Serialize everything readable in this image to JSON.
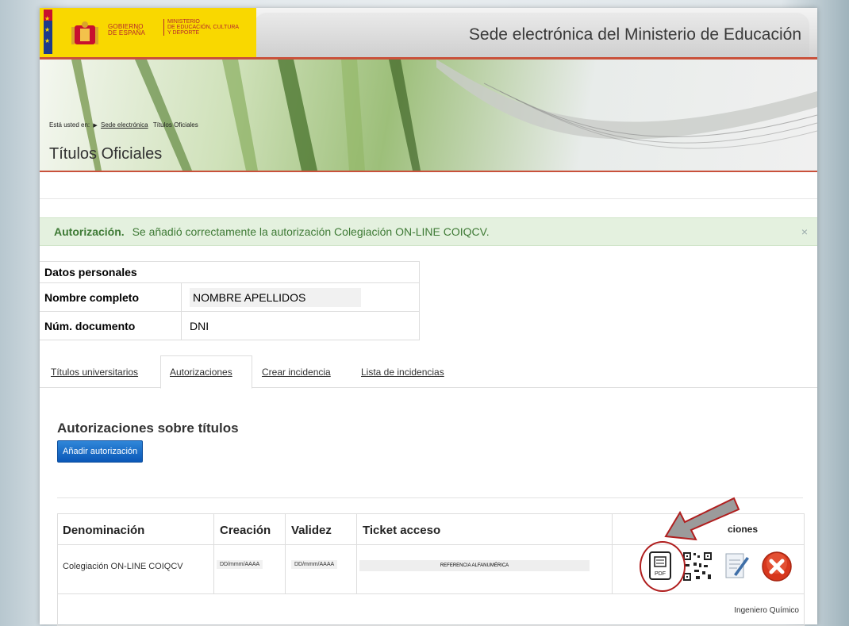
{
  "header": {
    "gov_line1": "GOBIERNO",
    "gov_line2": "DE ESPAÑA",
    "ministry_line1": "MINISTERIO",
    "ministry_line2": "DE EDUCACIÓN, CULTURA",
    "ministry_line3": "Y DEPORTE",
    "site_title": "Sede electrónica del Ministerio de Educación"
  },
  "breadcrumb": {
    "prefix": "Está usted en:",
    "link": "Sede electrónica",
    "current": "Títulos Oficiales"
  },
  "page_title": "Títulos Oficiales",
  "alert": {
    "strong": "Autorización.",
    "message": "Se añadió correctamente la autorización Colegiación ON-LINE COIQCV.",
    "close": "×"
  },
  "personal_data": {
    "title": "Datos personales",
    "rows": [
      {
        "label": "Nombre completo",
        "value": "NOMBRE APELLIDOS"
      },
      {
        "label": "Núm. documento",
        "value": "DNI"
      }
    ]
  },
  "tabs": [
    {
      "label": "Títulos universitarios"
    },
    {
      "label": "Autorizaciones"
    },
    {
      "label": "Crear incidencia"
    },
    {
      "label": "Lista de incidencias"
    }
  ],
  "section": {
    "title": "Autorizaciones sobre títulos",
    "add_button": "Añadir autorización"
  },
  "table": {
    "headers": {
      "name": "Denominación",
      "created": "Creación",
      "valid": "Validez",
      "ticket": "Ticket acceso",
      "actions": "ciones"
    },
    "row": {
      "name": "Colegiación ON-LINE COIQCV",
      "created": "DD/mmm/AAAA",
      "valid": "DD/mmm/AAAA",
      "ticket": "REFERENCIA ALFANUMÉRICA"
    },
    "footer_note": "Ingeniero Químico",
    "pdf_label": "PDF"
  },
  "colors": {
    "accent_red": "#c9513b",
    "alert_green": "#3e7a35",
    "button_blue": "#0b58b8"
  }
}
